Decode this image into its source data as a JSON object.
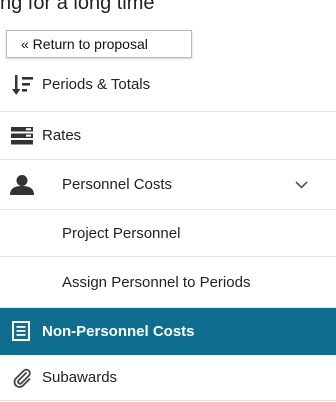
{
  "window": {
    "partial_top_text": "ng for a long time"
  },
  "return_button": {
    "label": "« Return to proposal"
  },
  "menu": {
    "items": [
      {
        "label": "Periods & Totals",
        "icon": "sort-periods-icon"
      },
      {
        "label": "Rates",
        "icon": "rates-list-icon"
      },
      {
        "label": "Personnel Costs",
        "icon": "person-icon",
        "expanded": true
      },
      {
        "label": "Project Personnel"
      },
      {
        "label": "Assign Personnel to Periods"
      },
      {
        "label": "Non-Personnel Costs",
        "icon": "document-icon",
        "active": true
      },
      {
        "label": "Subawards",
        "icon": "paperclip-icon"
      }
    ]
  },
  "colors": {
    "active_bg": "#0f6d8f",
    "text": "#222222",
    "divider": "#e3e3e3"
  }
}
